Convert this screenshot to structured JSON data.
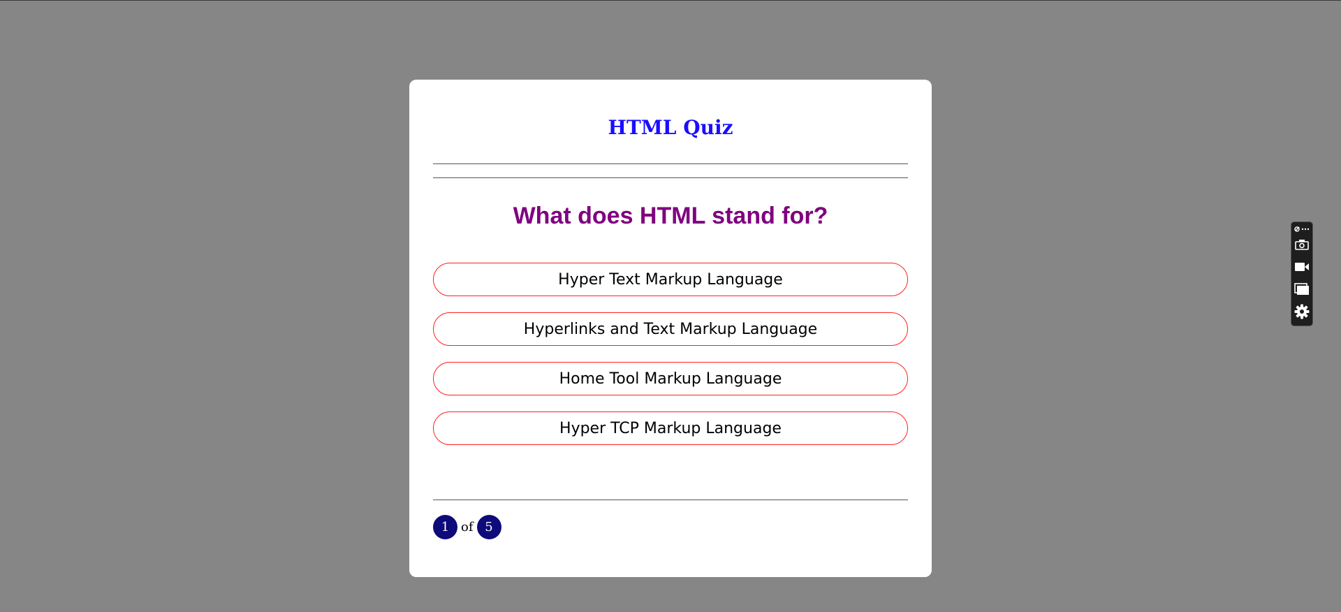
{
  "quiz": {
    "title": "HTML Quiz",
    "question": "What does HTML stand for?",
    "options": [
      {
        "label": "Hyper Text Markup Language"
      },
      {
        "label": "Hyperlinks and Text Markup Language"
      },
      {
        "label": "Home Tool Markup Language"
      },
      {
        "label": "Hyper TCP Markup Language"
      }
    ],
    "progress": {
      "current": "1",
      "of_label": "of",
      "total": "5"
    }
  },
  "toolbar": {
    "items": [
      "link-more-icon",
      "camera-icon",
      "video-camera-icon",
      "windows-icon",
      "gear-icon"
    ]
  },
  "colors": {
    "background": "#868686",
    "title": "#1a0dff",
    "question": "#800080",
    "option_border": "#ff2020",
    "progress_bubble": "#0d0a7a"
  }
}
